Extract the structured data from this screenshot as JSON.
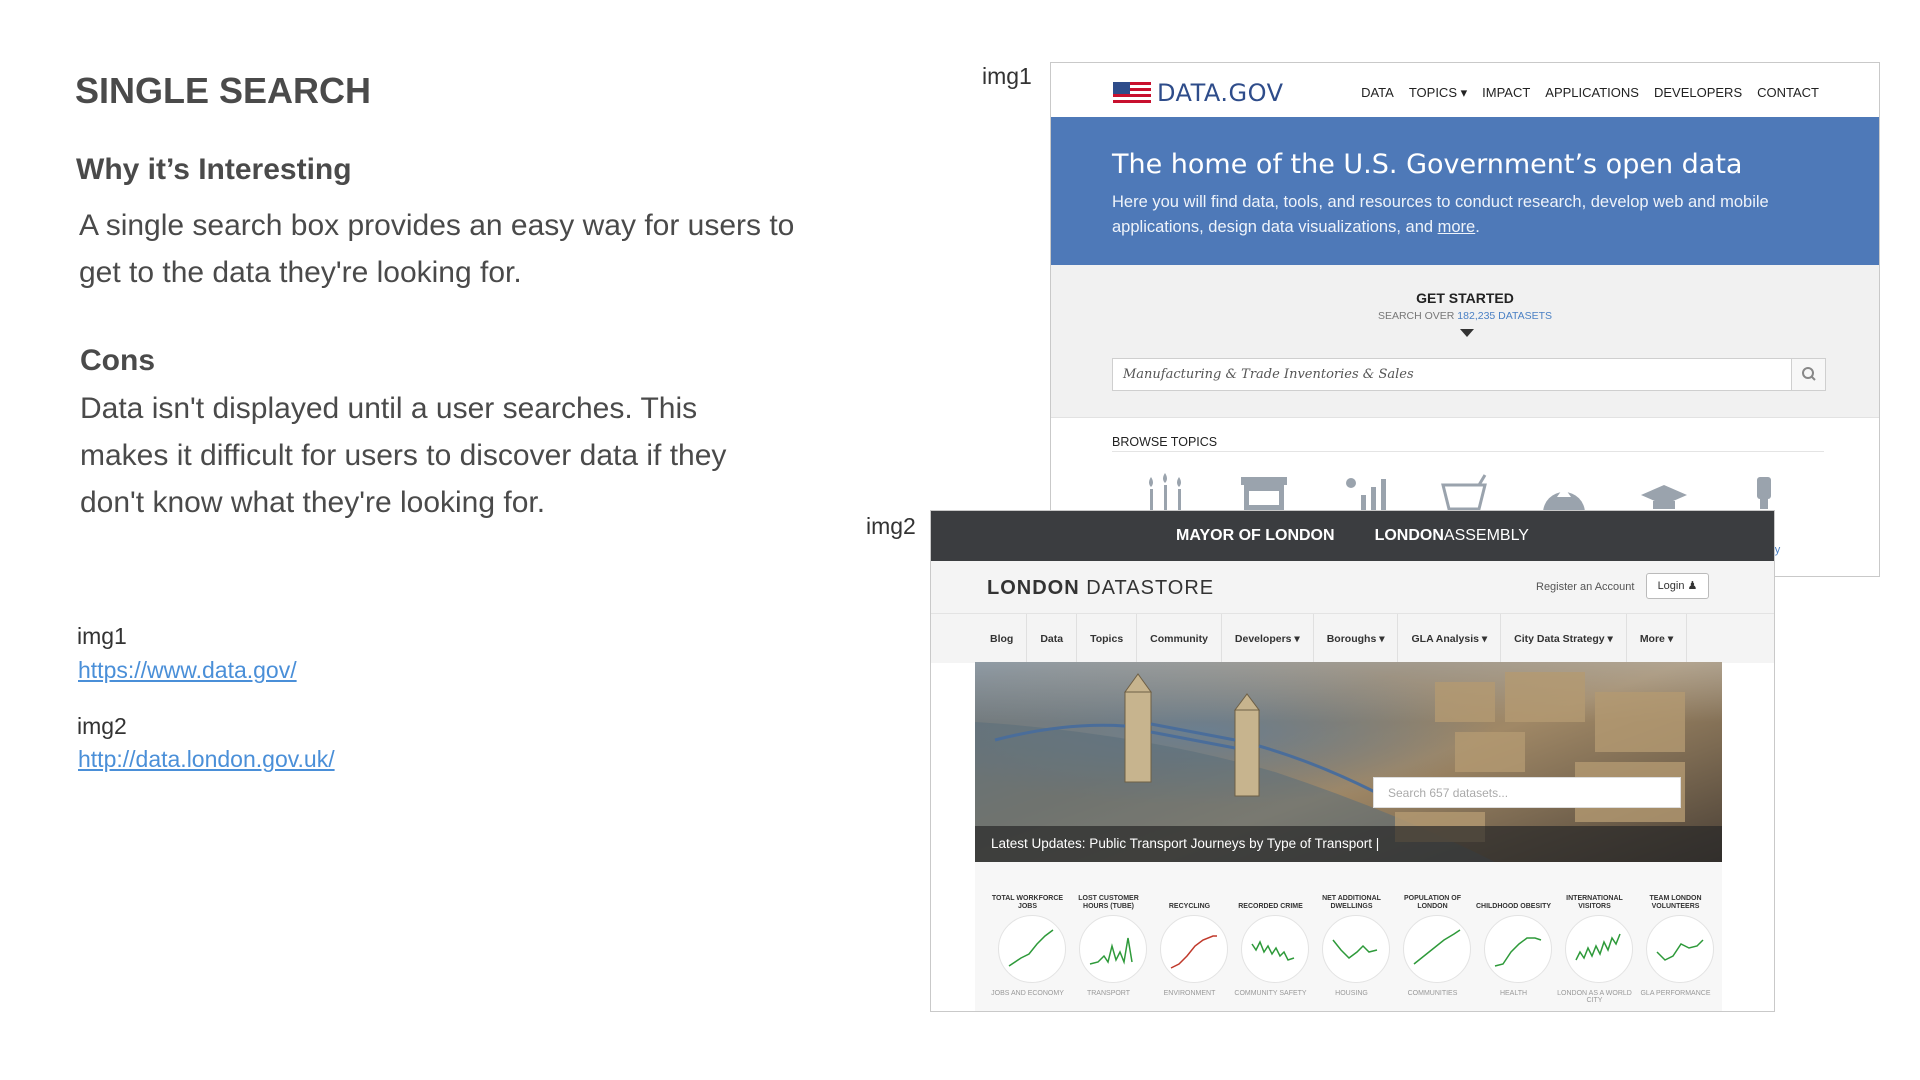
{
  "slide": {
    "title": "SINGLE SEARCH",
    "why_heading": "Why it’s Interesting",
    "why_text": "A single search box provides an easy way for users to get to the data they're looking for.",
    "cons_heading": "Cons",
    "cons_text": "Data isn't displayed until a user searches. This makes it difficult for users to discover data if they don't know what they're looking for.",
    "refs": [
      {
        "label": "img1",
        "url": "https://www.data.gov/"
      },
      {
        "label": "img2",
        "url": "http://data.london.gov.uk/"
      }
    ],
    "img1_tag": "img1",
    "img2_tag": "img2"
  },
  "datagov": {
    "logo": "DATA.GOV",
    "nav": [
      "DATA",
      "TOPICS ▾",
      "IMPACT",
      "APPLICATIONS",
      "DEVELOPERS",
      "CONTACT"
    ],
    "hero_title": "The home of the U.S. Government’s open data",
    "hero_sub": "Here you will find data, tools, and resources to conduct research, develop web and mobile applications, design data visualizations, and",
    "hero_more": "more",
    "get_started": "GET STARTED",
    "search_over": "SEARCH OVER",
    "dataset_count": "182,235 DATASETS",
    "search_value": "Manufacturing & Trade Inventories & Sales",
    "browse_topics": "BROWSE TOPICS",
    "partial_label": "rgy",
    "topic_icons": [
      "agriculture-icon",
      "business-icon",
      "climate-icon",
      "consumer-icon",
      "ecosystems-icon",
      "education-icon",
      "energy-icon"
    ],
    "brand_color": "#4e79b8"
  },
  "london": {
    "topbar_left": "MAYOR OF LONDON",
    "topbar_right_bold": "LONDON",
    "topbar_right": "ASSEMBLY",
    "logo_bold": "LONDON",
    "logo_rest": " DATASTORE",
    "register": "Register an Account",
    "login": "Login",
    "nav": [
      "Blog",
      "Data",
      "Topics",
      "Community",
      "Developers ▾",
      "Boroughs ▾",
      "GLA Analysis ▾",
      "City Data Strategy ▾",
      "More ▾"
    ],
    "search_placeholder": "Search 657 datasets...",
    "latest_update": "Latest Updates: Public Transport Journeys by Type of Transport",
    "kpis": [
      {
        "title": "TOTAL WORKFORCE JOBS",
        "category": "JOBS AND ECONOMY",
        "color": "#2e9a3a"
      },
      {
        "title": "LOST CUSTOMER HOURS (TUBE)",
        "category": "TRANSPORT",
        "color": "#2e9a3a"
      },
      {
        "title": "RECYCLING",
        "category": "ENVIRONMENT",
        "color": "#c0392b"
      },
      {
        "title": "RECORDED CRIME",
        "category": "COMMUNITY SAFETY",
        "color": "#2e9a3a"
      },
      {
        "title": "NET ADDITIONAL DWELLINGS",
        "category": "HOUSING",
        "color": "#2e9a3a"
      },
      {
        "title": "POPULATION OF LONDON",
        "category": "COMMUNITIES",
        "color": "#2e9a3a"
      },
      {
        "title": "CHILDHOOD OBESITY",
        "category": "HEALTH",
        "color": "#2e9a3a"
      },
      {
        "title": "INTERNATIONAL VISITORS",
        "category": "LONDON AS A WORLD CITY",
        "color": "#2e9a3a"
      },
      {
        "title": "TEAM LONDON VOLUNTEERS",
        "category": "GLA PERFORMANCE",
        "color": "#2e9a3a"
      }
    ]
  }
}
